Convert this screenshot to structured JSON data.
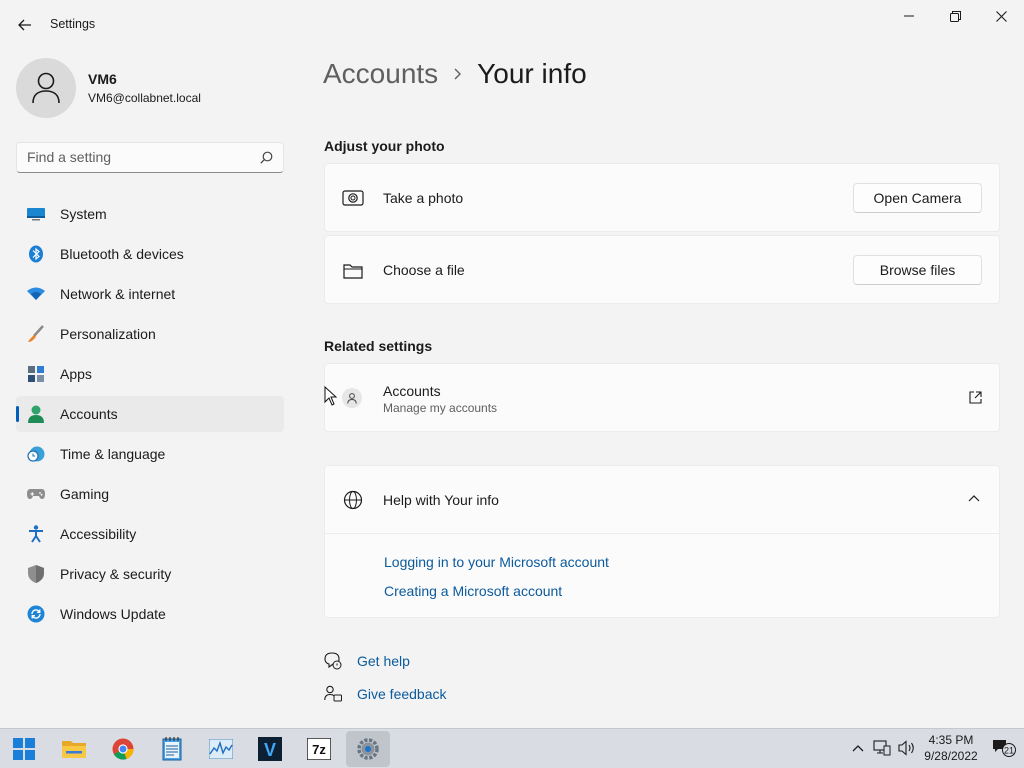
{
  "window": {
    "title": "Settings",
    "back_icon": "back-arrow-icon",
    "controls": [
      "minimize-icon",
      "maximize-icon",
      "close-icon"
    ]
  },
  "user": {
    "name": "VM6",
    "email": "VM6@collabnet.local"
  },
  "search": {
    "placeholder": "Find a setting",
    "value": ""
  },
  "sidebar": {
    "items": [
      {
        "label": "System",
        "icon": "system-icon",
        "selected": false
      },
      {
        "label": "Bluetooth & devices",
        "icon": "bluetooth-icon",
        "selected": false
      },
      {
        "label": "Network & internet",
        "icon": "wifi-icon",
        "selected": false
      },
      {
        "label": "Personalization",
        "icon": "brush-icon",
        "selected": false
      },
      {
        "label": "Apps",
        "icon": "apps-icon",
        "selected": false
      },
      {
        "label": "Accounts",
        "icon": "account-icon",
        "selected": true
      },
      {
        "label": "Time & language",
        "icon": "clock-globe-icon",
        "selected": false
      },
      {
        "label": "Gaming",
        "icon": "gamepad-icon",
        "selected": false
      },
      {
        "label": "Accessibility",
        "icon": "accessibility-icon",
        "selected": false
      },
      {
        "label": "Privacy & security",
        "icon": "shield-icon",
        "selected": false
      },
      {
        "label": "Windows Update",
        "icon": "update-icon",
        "selected": false
      }
    ]
  },
  "header": {
    "parent": "Accounts",
    "current": "Your info"
  },
  "photo": {
    "title": "Adjust your photo",
    "take": {
      "label": "Take a photo",
      "button": "Open Camera",
      "icon": "camera-icon"
    },
    "choose": {
      "label": "Choose a file",
      "button": "Browse files",
      "icon": "folder-icon"
    }
  },
  "related": {
    "title": "Related settings",
    "accounts": {
      "label": "Accounts",
      "sub": "Manage my accounts",
      "icon": "account-icon"
    }
  },
  "help": {
    "title": "Help with Your info",
    "links": [
      "Logging in to your Microsoft account",
      "Creating a Microsoft account"
    ]
  },
  "footer": {
    "get_help": "Get help",
    "feedback": "Give feedback"
  },
  "taskbar": {
    "apps": [
      "start-icon",
      "file-explorer-icon",
      "chrome-icon",
      "notepad-icon",
      "resource-monitor-icon",
      "v-app-icon",
      "7zip-icon",
      "settings-icon"
    ],
    "app_7zip_label": "7z",
    "app_v_label": "V",
    "time": "4:35 PM",
    "date": "9/28/2022",
    "notifications": "21"
  },
  "colors": {
    "accent": "#005fb8",
    "link": "#0b5a9c",
    "background": "#f3f3f3",
    "card": "#fbfbfb"
  }
}
